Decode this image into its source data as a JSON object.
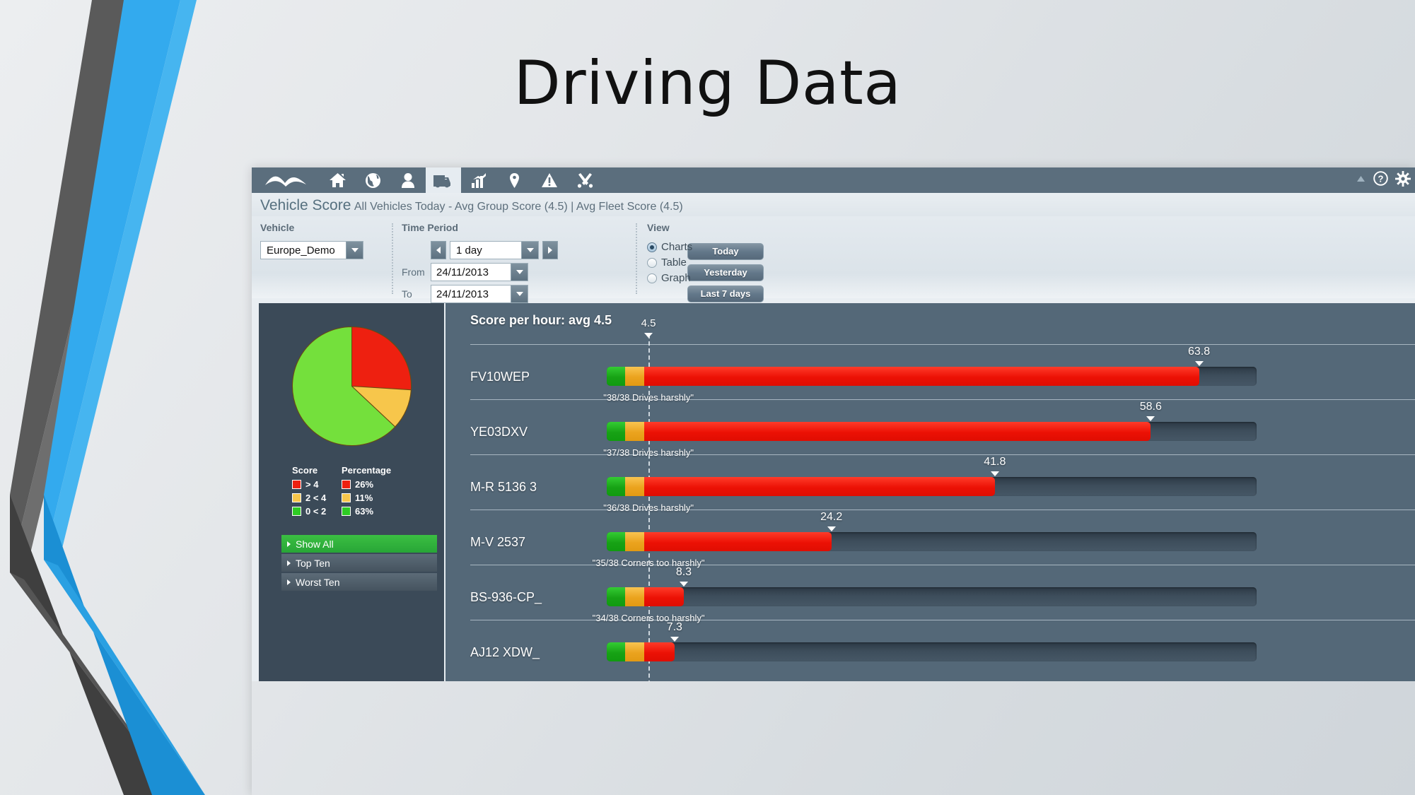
{
  "slide": {
    "title": "Driving Data"
  },
  "navbar": {
    "icons": [
      {
        "name": "logo-icon",
        "label": "Masternaut logo"
      },
      {
        "name": "home-icon",
        "label": "Home"
      },
      {
        "name": "globe-icon",
        "label": "Map"
      },
      {
        "name": "person-icon",
        "label": "Drivers"
      },
      {
        "name": "truck-icon",
        "label": "Vehicles"
      },
      {
        "name": "bar-chart-icon",
        "label": "Reports"
      },
      {
        "name": "pin-icon",
        "label": "Places"
      },
      {
        "name": "alert-icon",
        "label": "Alerts"
      },
      {
        "name": "tools-icon",
        "label": "Settings"
      }
    ],
    "right_icons": [
      {
        "name": "collapse-up-icon",
        "label": "Collapse"
      },
      {
        "name": "help-icon",
        "label": "Help"
      },
      {
        "name": "gear-icon",
        "label": "Settings"
      }
    ]
  },
  "page_header": {
    "title": "Vehicle Score",
    "subtitle": "All Vehicles Today - Avg Group Score (4.5) | Avg Fleet Score (4.5)"
  },
  "filters": {
    "vehicle": {
      "label": "Vehicle",
      "value": "Europe_Demo"
    },
    "time_period": {
      "label": "Time Period",
      "duration": "1 day",
      "from_label": "From",
      "from_value": "24/11/2013",
      "to_label": "To",
      "to_value": "24/11/2013",
      "buttons": [
        "Today",
        "Yesterday",
        "Last 7 days"
      ]
    },
    "view": {
      "label": "View",
      "options": [
        "Charts",
        "Table",
        "Graph"
      ],
      "selected": "Charts"
    }
  },
  "pie_panel": {
    "legend": {
      "head_score": "Score",
      "head_percentage": "Percentage",
      "rows": [
        {
          "score": "> 4",
          "percentage": "26%",
          "color": "#ee2010"
        },
        {
          "score": "2 < 4",
          "percentage": "11%",
          "color": "#f7c64b"
        },
        {
          "score": "0 < 2",
          "percentage": "63%",
          "color": "#2ecc24"
        }
      ]
    },
    "buttons": [
      {
        "label": "Show All",
        "active": true
      },
      {
        "label": "Top Ten",
        "active": false
      },
      {
        "label": "Worst Ten",
        "active": false
      }
    ]
  },
  "chart_data": {
    "type": "bar",
    "title": "Score per hour: avg 4.5",
    "xlabel": "",
    "ylabel": "",
    "grid": true,
    "legend": "left-panel",
    "average": 4.5,
    "average_label": "4.5",
    "xlim": [
      0,
      70
    ],
    "categories": [
      "FV10WEP",
      "YE03DXV",
      "M-R 5136 3",
      "M-V 2537",
      "BS-936-CP_",
      "AJ12 XDW_"
    ],
    "values": [
      63.8,
      58.6,
      41.8,
      24.2,
      8.3,
      7.3
    ],
    "value_labels": [
      "63.8",
      "58.6",
      "41.8",
      "24.2",
      "8.3",
      "7.3"
    ],
    "captions": [
      "\"38/38 Drives harshly\"",
      "\"37/38 Drives harshly\"",
      "\"36/38 Drives harshly\"",
      "\"35/38 Corners too harshly\"",
      "\"34/38 Corners too harshly\"",
      ""
    ],
    "band_colors": {
      "green": "#17a215",
      "orange": "#eba31e",
      "red": "#ec1105"
    },
    "band_thresholds": {
      "green_max": 2,
      "orange_max": 4
    },
    "pie": {
      "type": "pie",
      "labels": [
        "> 4",
        "2 < 4",
        "0 < 2"
      ],
      "values": [
        26,
        11,
        63
      ],
      "colors": [
        "#ee2010",
        "#f7c64b",
        "#74e03c"
      ]
    }
  }
}
